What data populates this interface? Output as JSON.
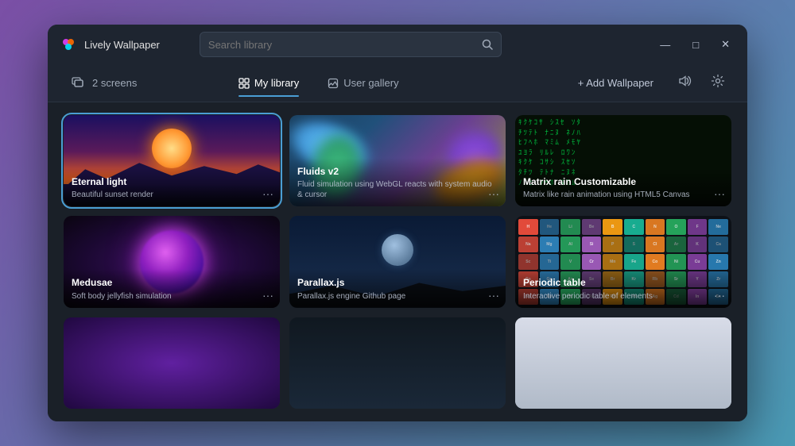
{
  "app": {
    "title": "Lively Wallpaper",
    "logo_colors": [
      "#f55",
      "#fa0",
      "#5f5",
      "#55f"
    ]
  },
  "titlebar": {
    "search_placeholder": "Search library",
    "controls": {
      "minimize": "—",
      "maximize": "□",
      "close": "✕"
    }
  },
  "toolbar": {
    "screens_icon": "⊡",
    "screens_label": "2 screens",
    "tabs": [
      {
        "id": "my-library",
        "icon": "⊞",
        "label": "My library",
        "active": true
      },
      {
        "id": "user-gallery",
        "icon": "⬜",
        "label": "User gallery",
        "active": false
      }
    ],
    "add_wallpaper_label": "+ Add Wallpaper",
    "volume_icon": "🔊",
    "settings_icon": "⚙"
  },
  "wallpapers": [
    {
      "id": "eternal-light",
      "title": "Eternal light",
      "description": "Beautiful sunset render",
      "selected": true
    },
    {
      "id": "fluids-v2",
      "title": "Fluids v2",
      "description": "Fluid simulation using WebGL reacts with system audio & cursor",
      "selected": false
    },
    {
      "id": "matrix-rain",
      "title": "Matrix rain Customizable",
      "description": "Matrix like rain animation using HTML5 Canvas",
      "selected": false
    },
    {
      "id": "medusa",
      "title": "Medusae",
      "description": "Soft body jellyfish simulation",
      "selected": false
    },
    {
      "id": "parallax",
      "title": "Parallax.js",
      "description": "Parallax.js engine Github page",
      "selected": false
    },
    {
      "id": "periodic-table",
      "title": "Periodic table",
      "description": "Interactive periodic table of elements",
      "selected": false
    },
    {
      "id": "bottom-1",
      "title": "",
      "description": "",
      "selected": false
    },
    {
      "id": "bottom-2",
      "title": "",
      "description": "",
      "selected": false
    },
    {
      "id": "bottom-3",
      "title": "",
      "description": "",
      "selected": false
    }
  ],
  "matrix_chars": "ｷｸｹｺｻｼｽｾｿﾀﾁﾂﾃﾄﾅﾆﾇﾈﾉﾊﾋﾌﾍﾎﾏﾐﾑﾒﾓﾔﾕﾖﾗﾘﾙﾚﾛﾜﾝ",
  "periodic_colors": [
    "#e74c3c",
    "#3498db",
    "#2ecc71",
    "#9b59b6",
    "#f39c12",
    "#1abc9c",
    "#e67e22",
    "#27ae60",
    "#8e44ad",
    "#2980b9"
  ]
}
